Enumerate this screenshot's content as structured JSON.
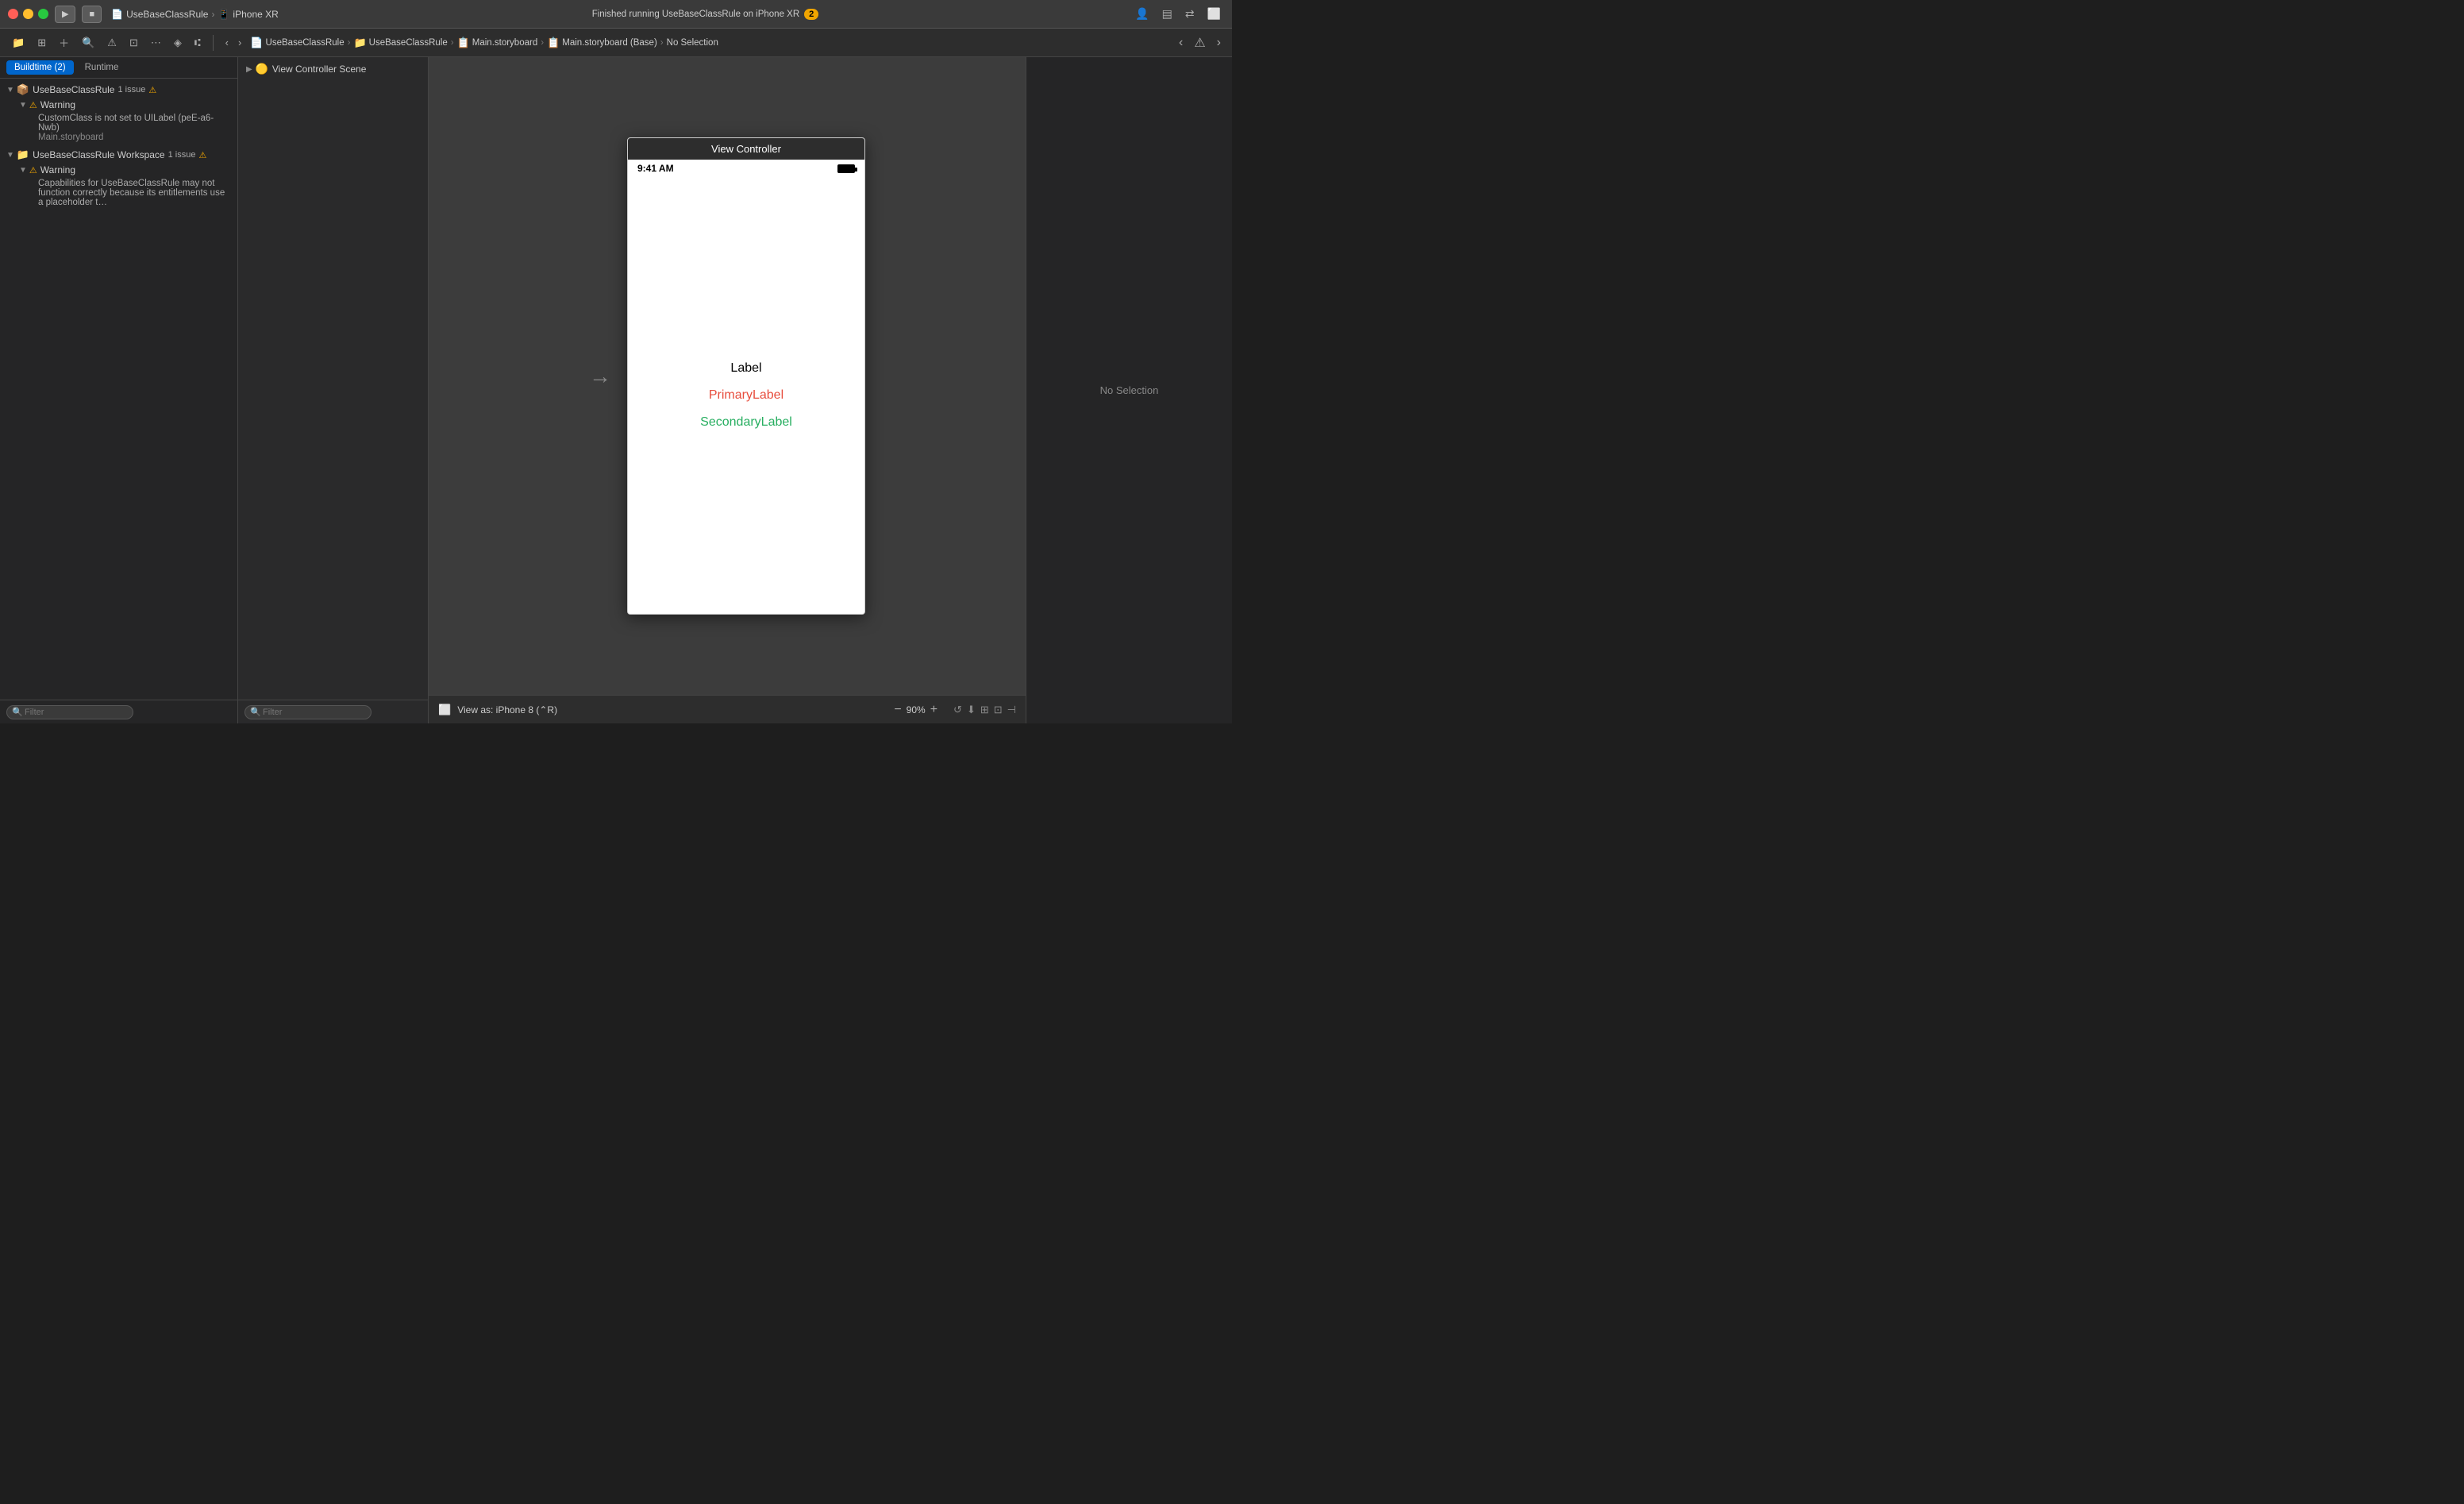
{
  "titleBar": {
    "trafficLights": [
      "close",
      "minimize",
      "maximize"
    ],
    "runLabel": "▶",
    "stopLabel": "■",
    "schemeLabel": "UseBaseClassRule",
    "deviceLabel": "iPhone XR",
    "statusText": "Finished running UseBaseClassRule on iPhone XR",
    "warningCount": "2"
  },
  "toolbar": {
    "breadcrumb": [
      {
        "label": "UseBaseClassRule",
        "icon": "📄"
      },
      {
        "label": "UseBaseClassRule",
        "icon": "📁"
      },
      {
        "label": "Main.storyboard",
        "icon": "📋"
      },
      {
        "label": "Main.storyboard (Base)",
        "icon": "📋"
      },
      {
        "label": "No Selection",
        "icon": ""
      }
    ]
  },
  "leftPanel": {
    "tabs": [
      {
        "label": "Buildtime (2)",
        "active": true
      },
      {
        "label": "Runtime",
        "active": false
      }
    ],
    "tree": [
      {
        "indent": 0,
        "arrow": "▼",
        "icon": "📦",
        "label": "UseBaseClassRule",
        "issueCount": "1 issue",
        "hasWarning": true
      },
      {
        "indent": 1,
        "arrow": "▼",
        "icon": "⚠",
        "label": "Warning",
        "issueCount": "",
        "hasWarning": false,
        "isWarning": true
      },
      {
        "indent": 2,
        "isDetail": true,
        "mainText": "CustomClass is not set to UILabel (peE-a6-Nwb)",
        "subText": "Main.storyboard"
      },
      {
        "indent": 0,
        "arrow": "▼",
        "icon": "📁",
        "label": "UseBaseClassRule Workspace",
        "issueCount": "1 issue",
        "hasWarning": true
      },
      {
        "indent": 1,
        "arrow": "▼",
        "icon": "⚠",
        "label": "Warning",
        "issueCount": "",
        "hasWarning": false,
        "isWarning": true
      },
      {
        "indent": 2,
        "isDetail": true,
        "mainText": "Capabilities for UseBaseClassRule may not function correctly because its entitlements use a placeholder t…",
        "subText": ""
      }
    ],
    "filterPlaceholder": "Filter"
  },
  "scenePanel": {
    "items": [
      {
        "label": "View Controller Scene",
        "icon": "🟡",
        "expanded": true
      }
    ],
    "filterPlaceholder": "Filter"
  },
  "canvas": {
    "iphone": {
      "titleBarLabel": "View Controller",
      "statusTime": "9:41 AM",
      "labels": [
        {
          "text": "Label",
          "type": "default"
        },
        {
          "text": "PrimaryLabel",
          "type": "primary"
        },
        {
          "text": "SecondaryLabel",
          "type": "secondary"
        }
      ]
    },
    "viewAsLabel": "View as: iPhone 8 (⌃R)",
    "zoomLevel": "90%"
  },
  "inspector": {
    "noSelectionLabel": "No Selection"
  }
}
